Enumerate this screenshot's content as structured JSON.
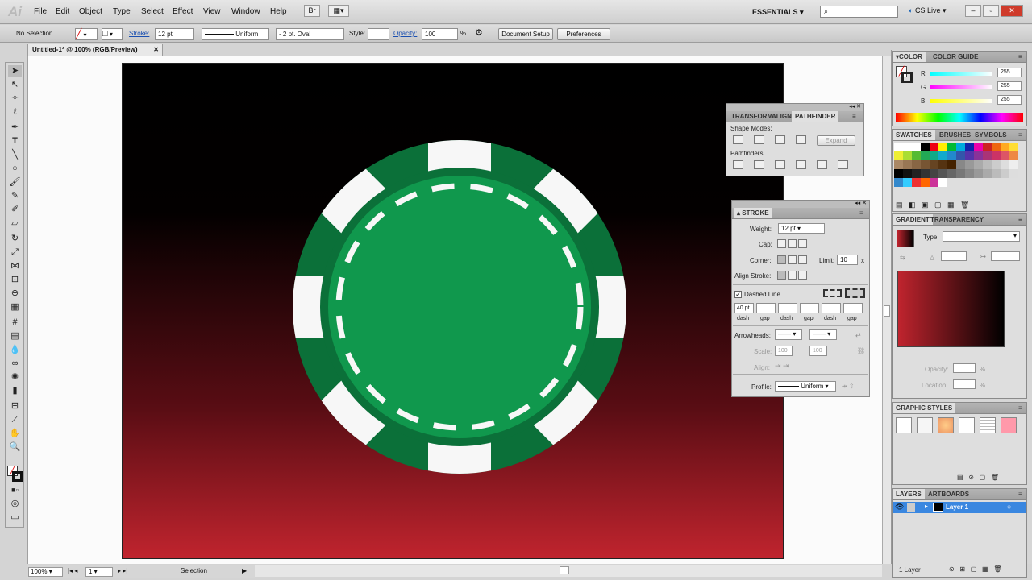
{
  "app": {
    "logo": "Ai",
    "workspace": "ESSENTIALS",
    "search_placeholder": "",
    "cslive": "CS Live"
  },
  "menu": [
    "File",
    "Edit",
    "Object",
    "Type",
    "Select",
    "Effect",
    "View",
    "Window",
    "Help"
  ],
  "menu_extra": {
    "bridge": "Br"
  },
  "control": {
    "selection": "No Selection",
    "stroke_label": "Stroke:",
    "stroke_weight": "12 pt",
    "profile": "Uniform",
    "brush": "2 pt. Oval",
    "style_label": "Style:",
    "opacity_label": "Opacity:",
    "opacity_value": "100",
    "opacity_unit": "%",
    "doc_setup": "Document Setup",
    "preferences": "Preferences"
  },
  "document": {
    "tab_title": "Untitled-1* @ 100% (RGB/Preview)",
    "zoom": "100%",
    "page": "1",
    "status": "Selection"
  },
  "colors": {
    "chip_dark": "#0b7039",
    "chip_light": "#10984d",
    "chip_white": "#f7f7f7",
    "red": "#c0242e"
  },
  "pathfinder": {
    "tabs": [
      "TRANSFORM",
      "ALIGN",
      "PATHFINDER"
    ],
    "shape_modes": "Shape Modes:",
    "pathfinders": "Pathfinders:",
    "expand": "Expand"
  },
  "stroke": {
    "title": "STROKE",
    "weight_label": "Weight:",
    "weight": "12 pt",
    "cap_label": "Cap:",
    "corner_label": "Corner:",
    "limit_label": "Limit:",
    "limit": "10",
    "limit_unit": "x",
    "align_label": "Align Stroke:",
    "dashed_label": "Dashed Line",
    "dash1": "40 pt",
    "dash_labels": [
      "dash",
      "gap",
      "dash",
      "gap",
      "dash",
      "gap"
    ],
    "arrowheads_label": "Arrowheads:",
    "scale_label": "Scale:",
    "scale1": "100",
    "scale2": "100",
    "align2_label": "Align:",
    "profile_label": "Profile:",
    "profile": "Uniform"
  },
  "color_panel": {
    "tabs": [
      "COLOR",
      "COLOR GUIDE"
    ],
    "r_label": "R",
    "g_label": "G",
    "b_label": "B",
    "r": "255",
    "g": "255",
    "b": "255"
  },
  "swatches": {
    "tabs": [
      "SWATCHES",
      "BRUSHES",
      "SYMBOLS"
    ]
  },
  "gradient": {
    "tabs": [
      "GRADIENT",
      "TRANSPARENCY"
    ],
    "type_label": "Type:",
    "opacity_label": "Opacity:",
    "location_label": "Location:",
    "pct": "%"
  },
  "graphic_styles": {
    "title": "GRAPHIC STYLES"
  },
  "layers": {
    "tabs": [
      "LAYERS",
      "ARTBOARDS"
    ],
    "layer1": "Layer 1",
    "count": "1 Layer"
  }
}
